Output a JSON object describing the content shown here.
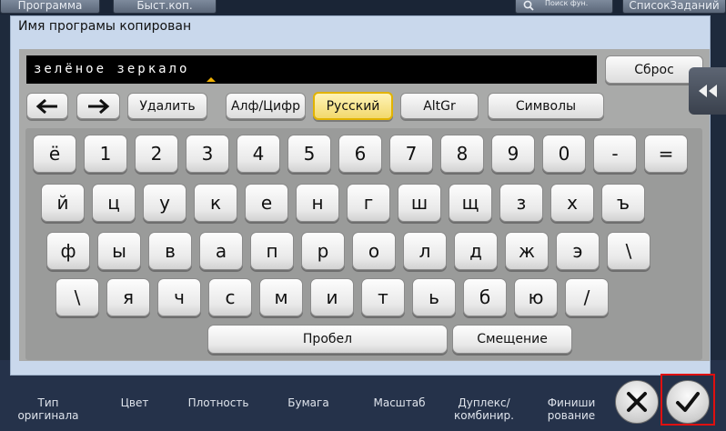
{
  "background": {
    "top_tabs": [
      "Программа",
      "Быст.коп.",
      "Поиск фун.",
      "СписокЗаданий"
    ],
    "bottom_labels": [
      {
        "line1": "Тип",
        "line2": "оригинала"
      },
      {
        "line1": "Цвет",
        "line2": ""
      },
      {
        "line1": "Плотность",
        "line2": ""
      },
      {
        "line1": "Бумага",
        "line2": ""
      },
      {
        "line1": "Масштаб",
        "line2": ""
      },
      {
        "line1": "Дуплекс/",
        "line2": "комбинир."
      },
      {
        "line1": "Финиши",
        "line2": "рование"
      }
    ]
  },
  "dialog": {
    "title": "Имя програмы копирован",
    "input_value": "зелёное зеркало",
    "reset_label": "Сброс"
  },
  "toolbar": {
    "delete_label": "Удалить",
    "alnum_label": "Алф/Цифр",
    "russian_label": "Русский",
    "altgr_label": "AltGr",
    "symbols_label": "Символы"
  },
  "keyboard": {
    "rows": [
      [
        "ё",
        "1",
        "2",
        "3",
        "4",
        "5",
        "6",
        "7",
        "8",
        "9",
        "0",
        "-",
        "="
      ],
      [
        "й",
        "ц",
        "у",
        "к",
        "е",
        "н",
        "г",
        "ш",
        "щ",
        "з",
        "х",
        "ъ"
      ],
      [
        "ф",
        "ы",
        "в",
        "а",
        "п",
        "р",
        "о",
        "л",
        "д",
        "ж",
        "э",
        "\\"
      ],
      [
        "\\",
        "я",
        "ч",
        "с",
        "м",
        "и",
        "т",
        "ь",
        "б",
        "ю",
        "/"
      ]
    ],
    "space_label": "Пробел",
    "shift_label": "Смещение"
  },
  "colors": {
    "dialog_bg": "#c9d8ec",
    "active_mode": "#f2d96c",
    "highlight_frame": "#e01010"
  },
  "icons": {
    "left_arrow": "arrow-left-icon",
    "right_arrow": "arrow-right-icon",
    "side_tab": "double-chevron-left-icon",
    "cancel": "close-x-icon",
    "ok": "checkmark-icon"
  }
}
